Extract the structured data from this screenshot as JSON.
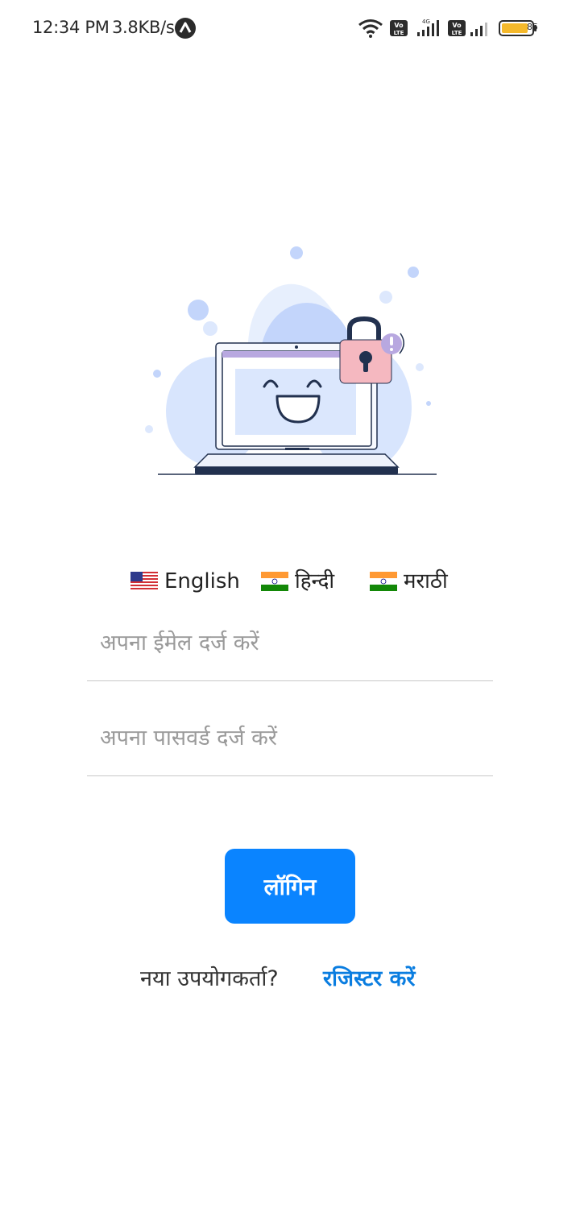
{
  "status_bar": {
    "time": "12:34 PM",
    "speed": "3.8KB/s",
    "battery": "85"
  },
  "languages": [
    {
      "flag": "us-flag-icon",
      "label": "English"
    },
    {
      "flag": "india-flag-icon",
      "label": "हिन्दी"
    },
    {
      "flag": "india-flag-icon",
      "label": "मराठी"
    }
  ],
  "form": {
    "email_placeholder": "अपना ईमेल दर्ज करें",
    "password_placeholder": "अपना पासवर्ड दर्ज करें",
    "login_label": "लॉगिन",
    "new_user_label": "नया उपयोगकर्ता?",
    "register_label": "रजिस्टर करें"
  },
  "colors": {
    "primary": "#0a84ff",
    "link": "#0a7de0"
  }
}
